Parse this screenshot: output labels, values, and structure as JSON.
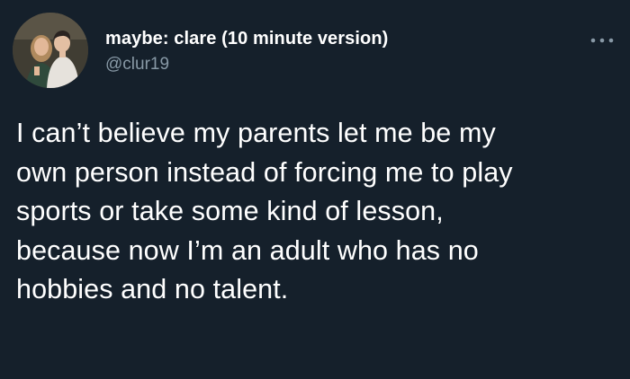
{
  "user": {
    "display_name": "maybe: clare (10 minute version)",
    "handle": "@clur19",
    "avatar_icon": "profile-photo"
  },
  "menu": {
    "icon": "more-icon"
  },
  "tweet": {
    "lines": [
      "I can’t believe my parents let me be my",
      "own person instead of forcing me to play",
      "sports or take some kind of lesson,",
      "because now I’m an adult who has no",
      "hobbies and no talent."
    ]
  },
  "colors": {
    "background": "#15202b",
    "text_primary": "#ffffff",
    "text_secondary": "#8899a6"
  }
}
